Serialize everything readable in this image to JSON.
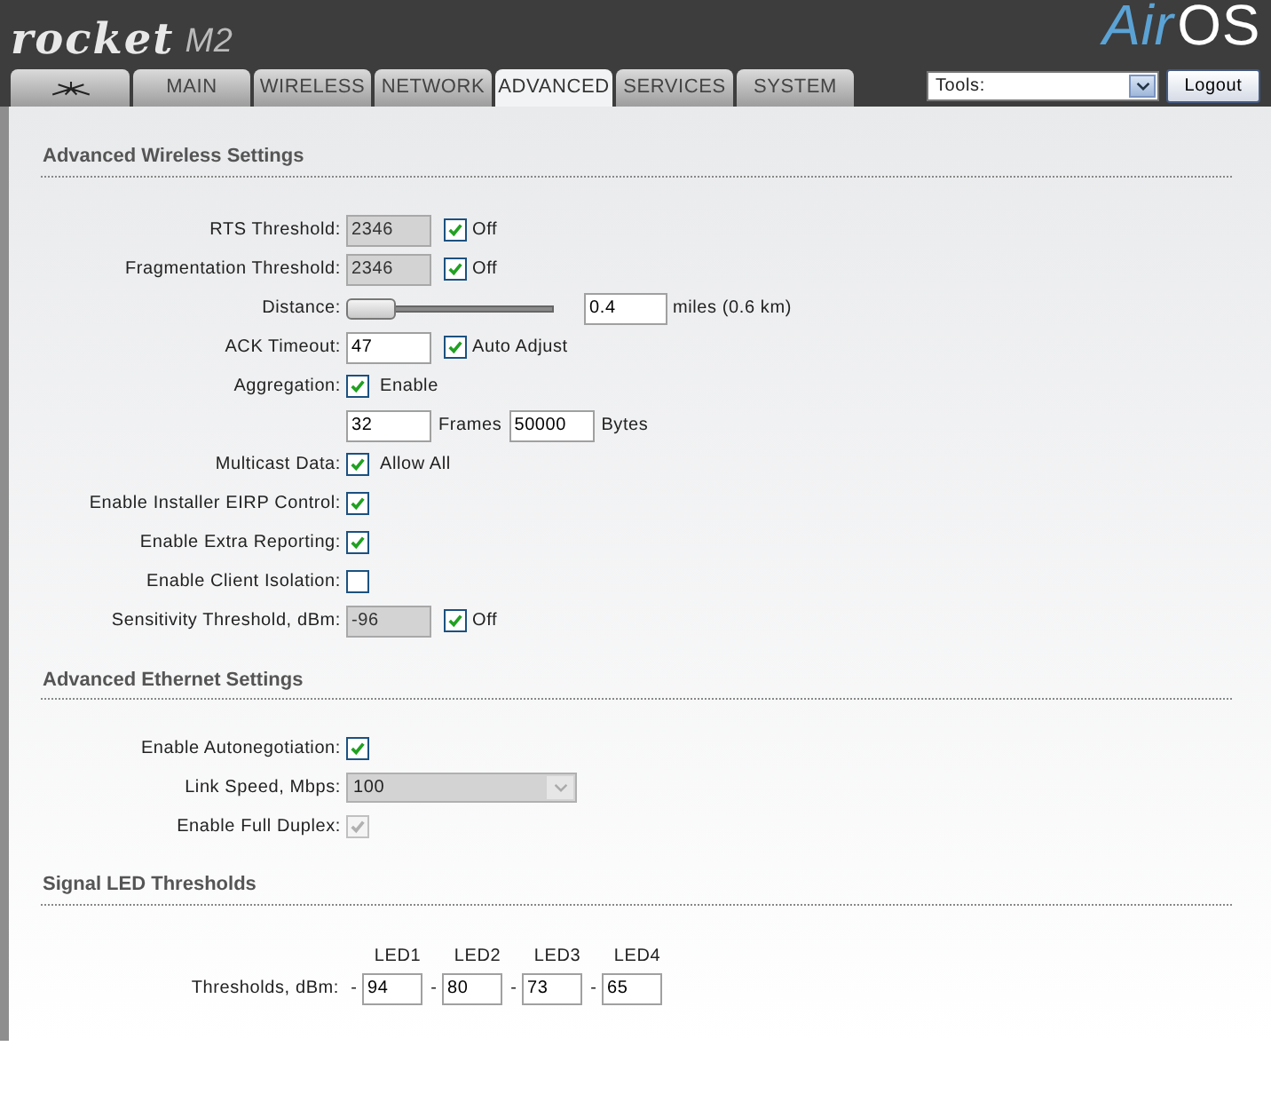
{
  "header": {
    "product": "rocket",
    "model": "M2",
    "brand_a": "Air",
    "brand_b": "OS"
  },
  "tabs": [
    {
      "kind": "icon",
      "selected": false
    },
    {
      "label": "MAIN",
      "selected": false
    },
    {
      "label": "WIRELESS",
      "selected": false
    },
    {
      "label": "NETWORK",
      "selected": false
    },
    {
      "label": "ADVANCED",
      "selected": true
    },
    {
      "label": "SERVICES",
      "selected": false
    },
    {
      "label": "SYSTEM",
      "selected": false
    }
  ],
  "tools": {
    "value": "Tools:"
  },
  "logout": "Logout",
  "sections": [
    {
      "title": "Advanced Wireless Settings",
      "rows": [
        {
          "kind": "input_check",
          "label": "RTS Threshold:",
          "value": "2346",
          "disabled": true,
          "check": {
            "checked": true,
            "text": "Off"
          }
        },
        {
          "kind": "input_check",
          "label": "Fragmentation Threshold:",
          "value": "2346",
          "disabled": true,
          "check": {
            "checked": true,
            "text": "Off"
          }
        },
        {
          "kind": "slider",
          "label": "Distance:",
          "level": 0,
          "value": "0.4",
          "unit": "miles (0.6 km)"
        },
        {
          "kind": "input_check",
          "label": "ACK Timeout:",
          "value": "47",
          "disabled": false,
          "check": {
            "checked": true,
            "text": "Auto Adjust"
          }
        },
        {
          "kind": "check",
          "label": "Aggregation:",
          "checked": true,
          "text": "Enable"
        },
        {
          "kind": "fields",
          "fields": [
            {
              "value": "32",
              "unit": "Frames"
            },
            {
              "value": "50000",
              "unit": "Bytes"
            }
          ]
        },
        {
          "kind": "check",
          "label": "Multicast Data:",
          "checked": true,
          "text": "Allow All"
        },
        {
          "kind": "check",
          "label": "Enable Installer EIRP Control:",
          "checked": true
        },
        {
          "kind": "check",
          "label": "Enable Extra Reporting:",
          "checked": true
        },
        {
          "kind": "check",
          "label": "Enable Client Isolation:",
          "checked": false
        },
        {
          "kind": "input_check",
          "label": "Sensitivity Threshold, dBm:",
          "value": "-96",
          "disabled": true,
          "check": {
            "checked": true,
            "text": "Off"
          }
        }
      ]
    },
    {
      "title": "Advanced Ethernet Settings",
      "rows": [
        {
          "kind": "check",
          "label": "Enable Autonegotiation:",
          "checked": true
        },
        {
          "kind": "select",
          "label": "Link Speed, Mbps:",
          "value": "100",
          "disabled": true
        },
        {
          "kind": "check",
          "label": "Enable Full Duplex:",
          "checked": true,
          "disabled": true
        }
      ]
    },
    {
      "title": "Signal LED Thresholds",
      "rows": [
        {
          "kind": "leds",
          "label": "Thresholds, dBm:",
          "leds": [
            {
              "name": "LED1",
              "sign": "-",
              "value": "94"
            },
            {
              "name": "LED2",
              "sign": "-",
              "value": "80"
            },
            {
              "name": "LED3",
              "sign": "-",
              "value": "73"
            },
            {
              "name": "LED4",
              "sign": "-",
              "value": "65"
            }
          ]
        }
      ]
    }
  ]
}
